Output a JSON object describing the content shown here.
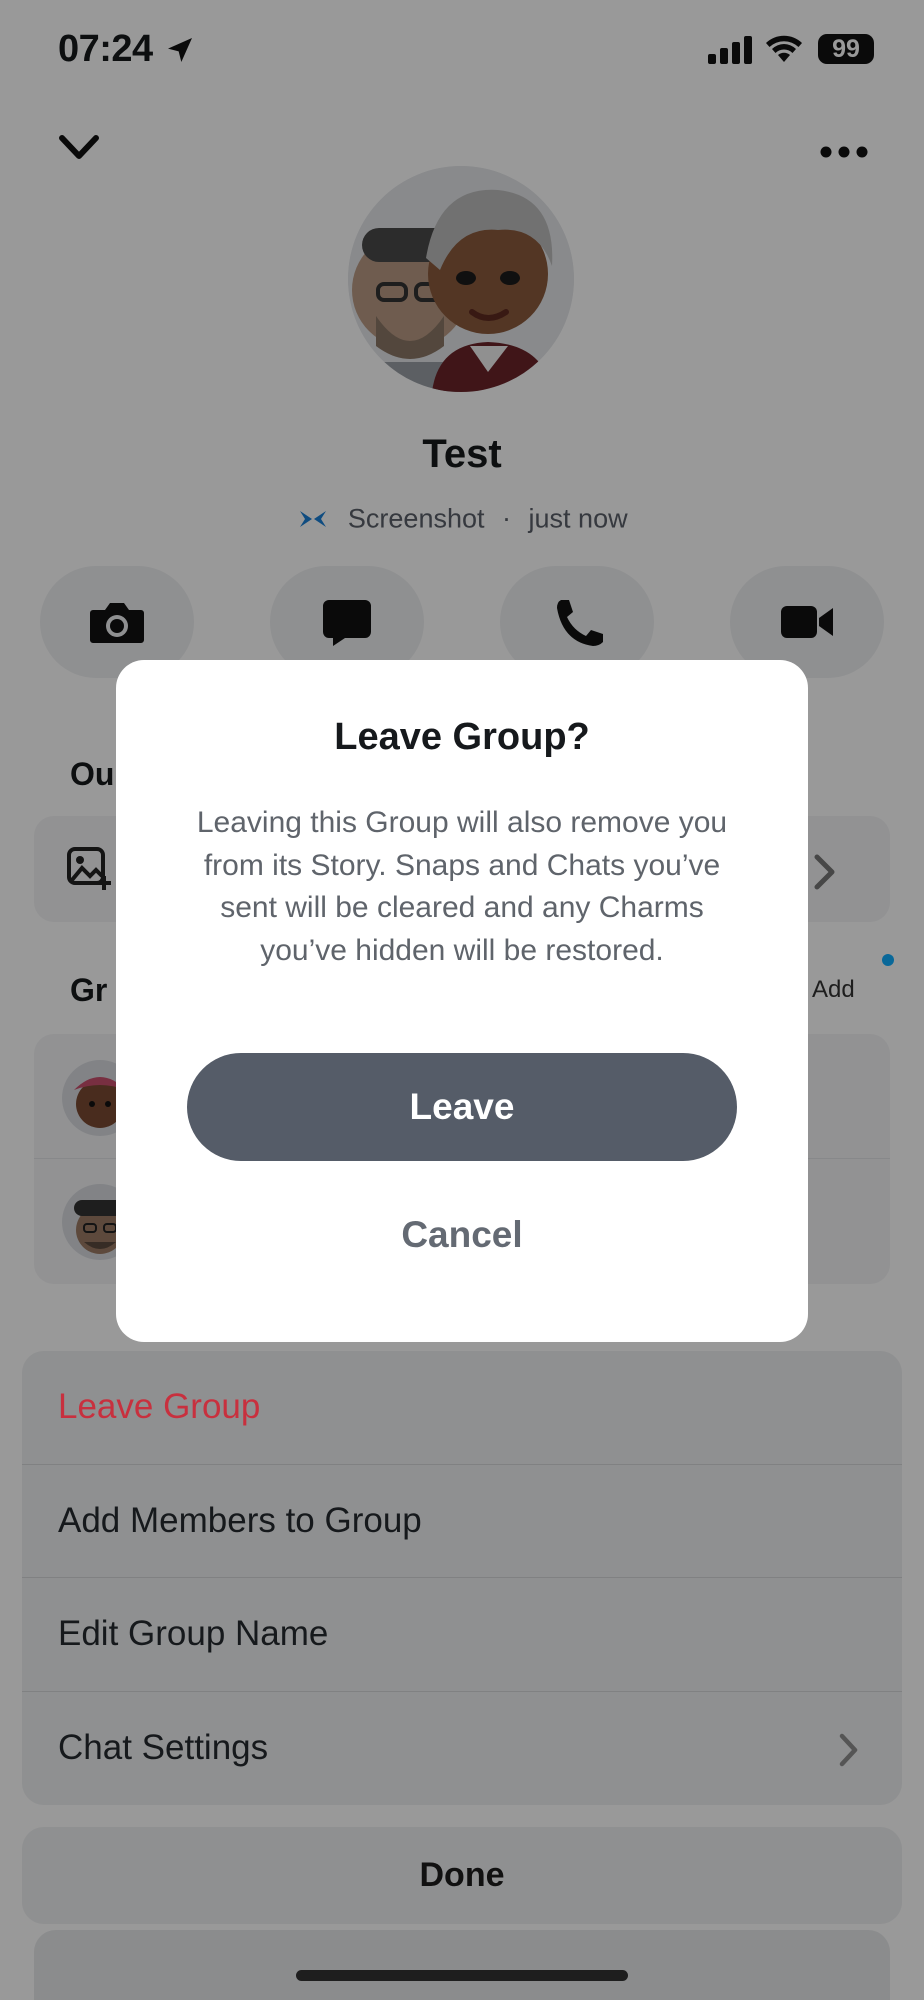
{
  "status_bar": {
    "time": "07:24",
    "battery": "99"
  },
  "header": {
    "title": "Test",
    "subtitle_activity": "Screenshot",
    "subtitle_separator": "·",
    "subtitle_time": "just now"
  },
  "actions": [
    "camera-icon",
    "chat-icon",
    "phone-icon",
    "video-icon"
  ],
  "background_partial": {
    "section_1_label": "Ou",
    "section_2_label": "Gr",
    "add_label": "Add"
  },
  "modal": {
    "title": "Leave Group?",
    "body": "Leaving this Group will also remove you from its Story. Snaps and Chats you’ve sent will be cleared and any Charms you’ve hidden will be restored.",
    "primary_label": "Leave",
    "secondary_label": "Cancel"
  },
  "action_sheet": {
    "items": [
      {
        "label": "Leave Group",
        "style": "destructive"
      },
      {
        "label": "Add Members to Group"
      },
      {
        "label": "Edit Group Name"
      },
      {
        "label": "Chat Settings"
      }
    ],
    "done_label": "Done"
  },
  "colors": {
    "destructive": "#c8303e",
    "primary_button": "#555c68",
    "accent_blue": "#0fadff"
  }
}
